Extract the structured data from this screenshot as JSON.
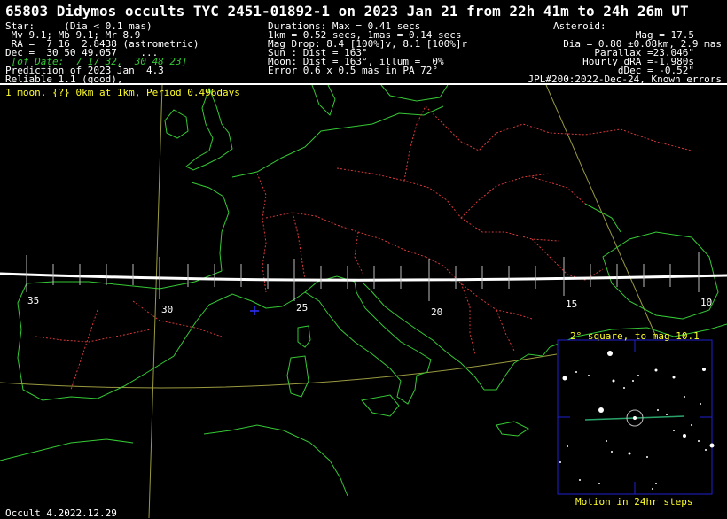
{
  "title": "65803 Didymos occults TYC 2451-01892-1 on 2023 Jan 21 from 22h 41m to 24h 26m UT",
  "star": {
    "l1": "Star:     (Dia < 0.1 mas)",
    "l2": " Mv 9.1; Mb 9.1; Mr 8.9",
    "l3": " RA =  7 16  2.8438 (astrometric)",
    "l4": "Dec =  30 50 49.057    ...",
    "l5": " [of Date:  7 17 32,  30 48 23]",
    "l6": "Prediction of 2023 Jan  4.3",
    "l7": "Reliable 1.1 (good),"
  },
  "event": {
    "l1": "Durations: Max = 0.41 secs",
    "l2": "1km = 0.52 secs, 1mas = 0.14 secs",
    "l3": "Mag Drop: 8.4 [100%]v, 8.1 [100%]r",
    "l4": "Sun : Dist = 163°",
    "l5": "Moon: Dist = 163°, illum =  0%",
    "l6": "Error 0.6 x 0.5 mas in PA 72°"
  },
  "asteroid": {
    "l1": "Asteroid:",
    "l2": "Mag = 17.5",
    "l3": "Dia = 0.80 ±0.08km, 2.9 mas",
    "l4": "Parallax =23.046\"",
    "l5": "Hourly dRA =-1.980s",
    "l6": "dDec = -0.52\"",
    "l7": "JPL#200:2022-Dec-24, Known errors"
  },
  "moon_note": "1 moon. {?} 0km at 1km, Period 0.496days",
  "longitude_labels": [
    "35",
    "30",
    "25",
    "20",
    "15",
    "10"
  ],
  "inset": {
    "title": "2° square, to mag 10.1",
    "footer": "Motion in 24hr steps"
  },
  "footer": "Occult 4.2022.12.29",
  "colors": {
    "coast": "#35c935",
    "border": "#d83a3a",
    "path": "#ffffff",
    "inset_frame": "#2020d0",
    "highlight": "#ffff2a"
  }
}
